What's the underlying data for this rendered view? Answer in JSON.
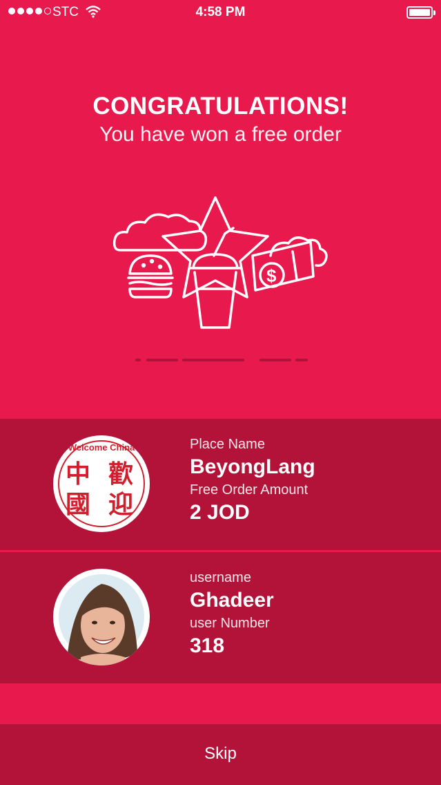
{
  "status_bar": {
    "carrier": "STC",
    "time": "4:58 PM"
  },
  "header": {
    "title": "CONGRATULATIONS!",
    "subtitle": "You have won a free order"
  },
  "place_card": {
    "name_label": "Place Name",
    "name_value": "BeyongLang",
    "amount_label": "Free Order Amount",
    "amount_value": "2 JOD",
    "logo_text_top": "Welcome China",
    "logo_chars": [
      "中",
      "歡",
      "國",
      "迎"
    ]
  },
  "user_card": {
    "username_label": "username",
    "username_value": "Ghadeer",
    "number_label": "user Number",
    "number_value": "318"
  },
  "footer": {
    "skip_label": "Skip"
  },
  "colors": {
    "background": "#E8194D",
    "card": "#B31339",
    "logo_red": "#D0202E"
  }
}
